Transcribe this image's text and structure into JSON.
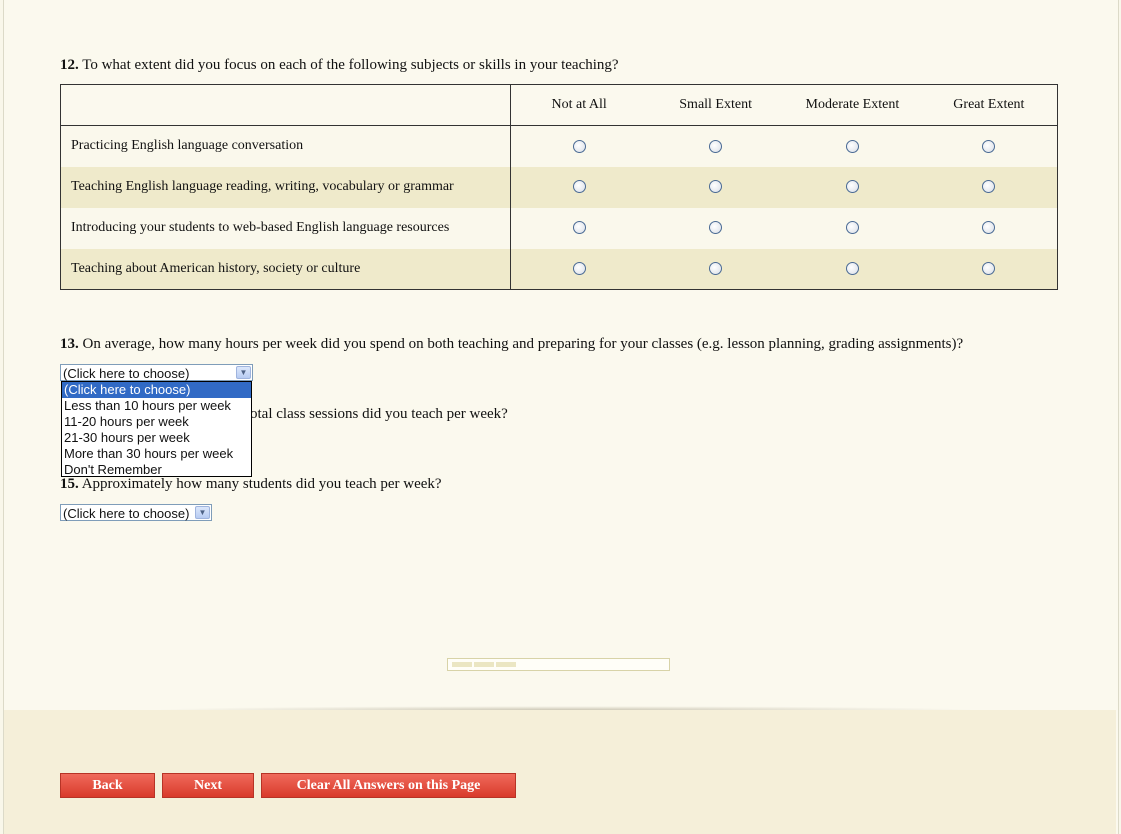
{
  "q12": {
    "number": "12.",
    "text": "To what extent did you focus on each of the following subjects or skills in your teaching?",
    "columns": [
      "Not at All",
      "Small Extent",
      "Moderate Extent",
      "Great Extent"
    ],
    "rows": [
      "Practicing English language conversation",
      "Teaching English language reading, writing, vocabulary or grammar",
      "Introducing your students to web-based English language resources",
      "Teaching about American history, society or culture"
    ]
  },
  "q13": {
    "number": "13.",
    "text": "On average, how many hours per week did you spend on both teaching and preparing for your classes (e.g. lesson planning, grading assignments)?",
    "selected": "(Click here to choose)",
    "options": [
      "(Click here to choose)",
      "Less than 10 hours per week",
      "11-20 hours per week",
      "21-30 hours per week",
      "More than 30 hours per week",
      "Don't Remember"
    ]
  },
  "q14": {
    "text_visible": "otal class sessions did you teach per week?"
  },
  "q15": {
    "number": "15.",
    "text": "Approximately how many students did you teach per week?",
    "selected": "(Click here to choose)"
  },
  "progress": {
    "segments_filled": 3
  },
  "buttons": {
    "back": "Back",
    "next": "Next",
    "clear": "Clear All Answers on this Page"
  },
  "colors": {
    "button_red": "#e04a3a",
    "row_alt": "#efeacb",
    "selected_option": "#316ac5"
  }
}
